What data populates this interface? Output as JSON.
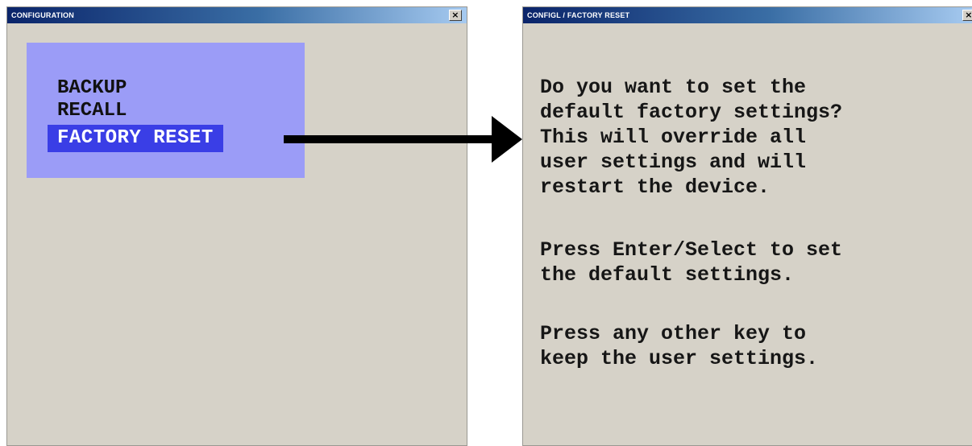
{
  "left_window": {
    "title": "CONFIGURATION",
    "close_label": "×",
    "menu_items": [
      "BACKUP",
      "RECALL",
      "FACTORY RESET"
    ],
    "selected_item": "FACTORY RESET"
  },
  "right_window": {
    "title": "CONFIGL / FACTORY RESET",
    "close_label": "×",
    "message_paragraphs": [
      "Do you want to set the\ndefault factory settings?\nThis will override all\nuser settings and will\nrestart the device.",
      "Press Enter/Select to set\nthe default settings.",
      "Press any other key to\nkeep the user settings."
    ]
  },
  "colors": {
    "window_bg": "#d6d2c8",
    "menu_panel": "#9b9cf7",
    "selection": "#3a3ee6",
    "titlebar": "#0a246a"
  },
  "icons": {
    "arrow": "right-arrow-icon",
    "close": "close-icon"
  }
}
